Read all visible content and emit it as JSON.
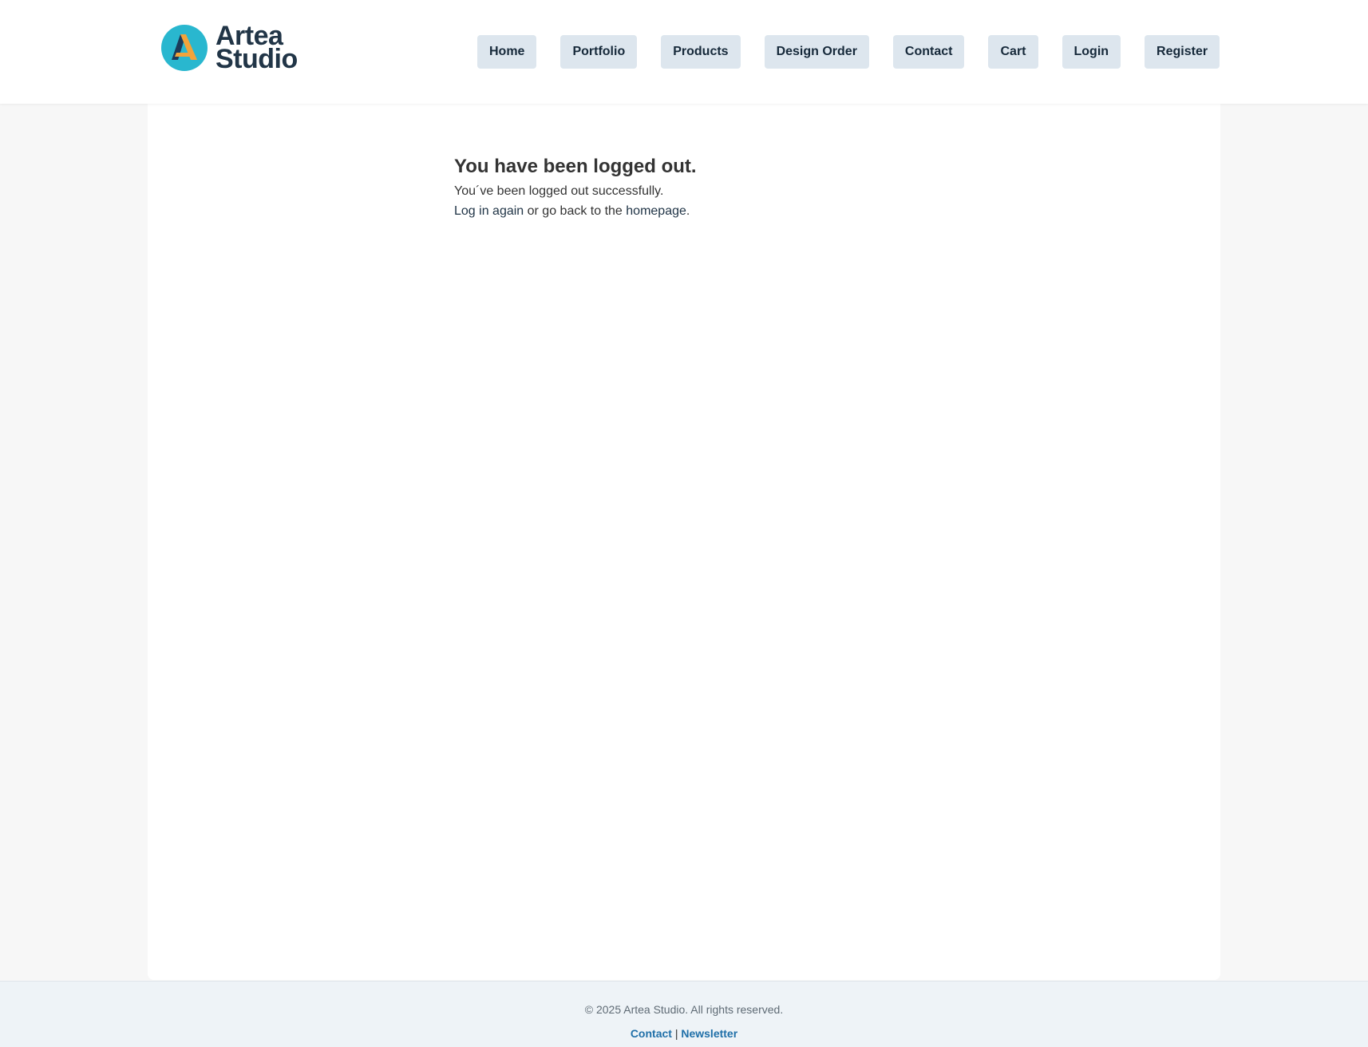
{
  "brand": {
    "line1": "Artea",
    "line2": "Studio",
    "colors": {
      "circle": "#29b7cf",
      "mark_dark": "#1b3b5a",
      "mark_accent": "#f2a33a",
      "text": "#213547"
    }
  },
  "nav": {
    "items": [
      {
        "label": "Home"
      },
      {
        "label": "Portfolio"
      },
      {
        "label": "Products"
      },
      {
        "label": "Design Order"
      },
      {
        "label": "Contact"
      },
      {
        "label": "Cart"
      },
      {
        "label": "Login"
      },
      {
        "label": "Register"
      }
    ]
  },
  "main": {
    "heading": "You have been logged out.",
    "message": "You´ve been logged out successfully.",
    "login_link": "Log in again",
    "middle_text": " or go back to the ",
    "home_link": "homepage",
    "end_text": "."
  },
  "footer": {
    "copyright": "© 2025 Artea Studio. All rights reserved.",
    "contact_link": "Contact",
    "separator": " | ",
    "newsletter_link": "Newsletter"
  }
}
